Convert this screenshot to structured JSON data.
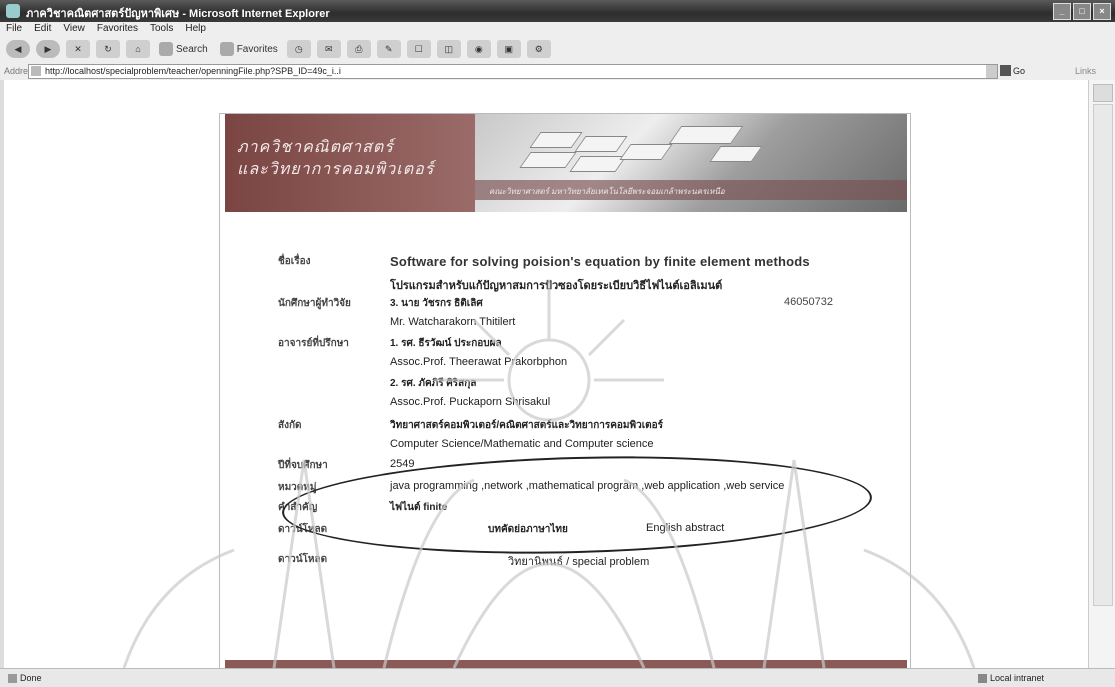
{
  "window": {
    "title": "ภาควิชาคณิตศาสตร์ปัญหาพิเศษ - Microsoft Internet Explorer",
    "buttons": [
      "_",
      "□",
      "×"
    ]
  },
  "menu": [
    "File",
    "Edit",
    "View",
    "Favorites",
    "Tools",
    "Help"
  ],
  "toolbar": {
    "search_label": "Search",
    "favorites_label": "Favorites"
  },
  "address": {
    "label": "Address",
    "url": "http://localhost/specialproblem/teacher/openningFile.php?SPB_ID=49c_i..i",
    "go_label": "Go",
    "links_label": "Links"
  },
  "banner": {
    "line1": "ภาควิชาคณิตศาสตร์",
    "line2": "และวิทยาการคอมพิวเตอร์",
    "strip_text": "คณะวิทยาศาสตร์ มหาวิทยาลัยเทคโนโลยีพระจอมเกล้าพระนครเหนือ"
  },
  "project": {
    "topic_label": "ชื่อเรื่อง",
    "title_en": "Software for solving poision's equation by finite element methods",
    "title_th": "โปรแกรมสำหรับแก้ปัญหาสมการปัวซองโดยระเบียบวิธีไฟไนต์เอลิเมนต์",
    "researcher_label": "นักศึกษาผู้ทำวิจัย",
    "researcher_th": "3. นาย วัชรกร ธิติเลิศ",
    "researcher_id": "46050732",
    "researcher_en": "Mr. Watcharakorn Thitilert",
    "advisor_label": "อาจารย์ที่ปรึกษา",
    "advisor1_th": "1. รศ. ธีรวัฒน์ ประกอบผล",
    "advisor1_en": "Assoc.Prof. Theerawat Prakorbphon",
    "advisor2_th": "2. รศ. ภัคภิรี ศิริสกุล",
    "advisor2_en": "Assoc.Prof. Puckaporn Shrisakul",
    "dept_label": "สังกัด",
    "dept_th": "วิทยาศาสตร์คอมพิวเตอร์/คณิตศาสตร์และวิทยาการคอมพิวเตอร์",
    "dept_en": "Computer Science/Mathematic and Computer science",
    "year_label": "ปีที่จบศึกษา",
    "year": "2549",
    "category_label": "หมวดหมู่",
    "category": "java programming ,network ,mathematical program ,web application ,web service",
    "keyword_label": "คำสำคัญ",
    "keyword": "ไฟไนต์ finite",
    "abstract_label": "ดาวน์โหลด",
    "abstract_th": "บทคัดย่อภาษาไทย",
    "abstract_en": "English abstract",
    "download_label": "ดาวน์โหลด",
    "download_link": "วิทยานิพนธ์ / special problem"
  },
  "status": {
    "left": "Done",
    "zone": "Local intranet"
  }
}
